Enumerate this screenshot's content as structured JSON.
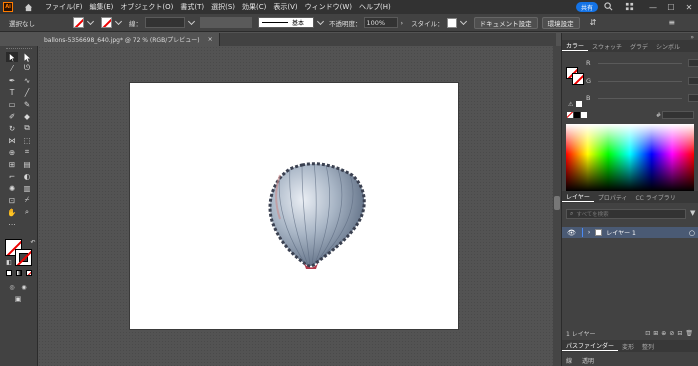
{
  "menubar": {
    "app_icon": "Ai",
    "items": [
      "ファイル(F)",
      "編集(E)",
      "オブジェクト(O)",
      "書式(T)",
      "選択(S)",
      "効果(C)",
      "表示(V)",
      "ウィンドウ(W)",
      "ヘルプ(H)"
    ],
    "share_label": "共有"
  },
  "controlbar": {
    "selection_label": "選択なし",
    "stroke_label": "線：",
    "stroke_style_label": "基本",
    "opacity_label": "不透明度：",
    "opacity_value": "100%",
    "style_label": "スタイル：",
    "doc_setup_label": "ドキュメント設定",
    "prefs_label": "環境設定"
  },
  "document_tab": {
    "title": "ballons-5356698_640.jpg* @ 72 % (RGB/プレビュー)",
    "close": "×"
  },
  "color_panel": {
    "tabs": [
      "カラー",
      "スウォッチ",
      "グラデ",
      "シンボル"
    ],
    "channels": [
      "R",
      "G",
      "B"
    ],
    "hex_prefix": "#"
  },
  "layers_panel": {
    "tabs": [
      "レイヤー",
      "プロパティ",
      "CC ライブラリ"
    ],
    "search_placeholder": "すべてを検索",
    "layer_name": "レイヤー 1",
    "footer_count": "1 レイヤー"
  },
  "pathfinder_panel": {
    "tabs": [
      "パスファインダー",
      "変形",
      "整列"
    ],
    "row": [
      "線",
      "透明"
    ]
  },
  "colors": {
    "accent": "#1473e6",
    "ai_orange": "#ff7c00"
  }
}
